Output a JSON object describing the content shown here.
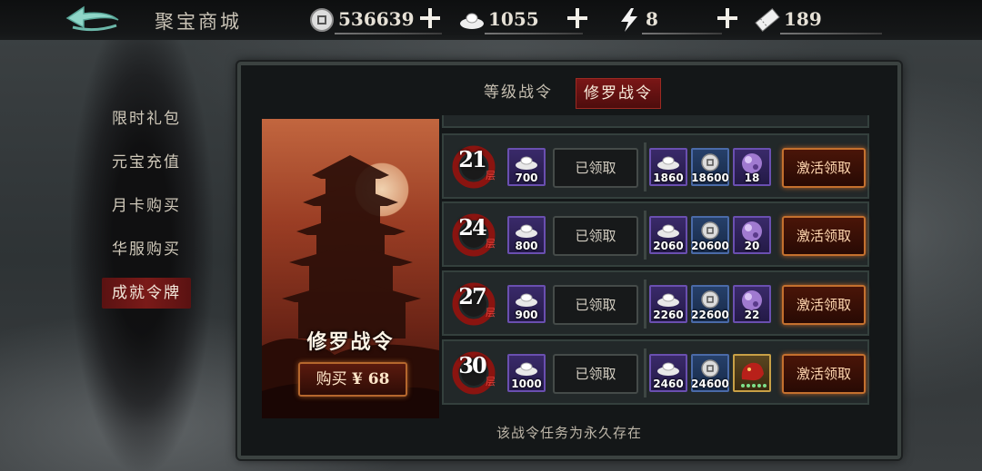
{
  "header": {
    "title": "聚宝商城",
    "resources": [
      {
        "icon": "copper-coin-icon",
        "value": "536639"
      },
      {
        "icon": "silver-ingot-icon",
        "value": "1055"
      },
      {
        "icon": "lightning-icon",
        "value": "8"
      },
      {
        "icon": "ticket-icon",
        "value": "189"
      }
    ]
  },
  "sidebar": {
    "items": [
      {
        "label": "限时礼包"
      },
      {
        "label": "元宝充值"
      },
      {
        "label": "月卡购买"
      },
      {
        "label": "华服购买"
      },
      {
        "label": "成就令牌",
        "active": true
      }
    ]
  },
  "tabs": [
    {
      "label": "等级战令"
    },
    {
      "label": "修罗战令",
      "active": true
    }
  ],
  "banner": {
    "title": "修罗战令",
    "buy_label": "购买",
    "price": "¥ 68"
  },
  "rows": [
    {
      "level": "21",
      "unit": "层",
      "free_reward": {
        "icon": "silver-ingot-icon",
        "qty": "700"
      },
      "claim_label": "已领取",
      "paid_rewards": [
        {
          "icon": "silver-ingot-icon",
          "qty": "1860"
        },
        {
          "icon": "copper-coin-icon",
          "qty": "18600"
        },
        {
          "icon": "purple-orb-icon",
          "qty": "18"
        }
      ],
      "activate_label": "激活领取"
    },
    {
      "level": "24",
      "unit": "层",
      "free_reward": {
        "icon": "silver-ingot-icon",
        "qty": "800"
      },
      "claim_label": "已领取",
      "paid_rewards": [
        {
          "icon": "silver-ingot-icon",
          "qty": "2060"
        },
        {
          "icon": "copper-coin-icon",
          "qty": "20600"
        },
        {
          "icon": "purple-orb-icon",
          "qty": "20"
        }
      ],
      "activate_label": "激活领取"
    },
    {
      "level": "27",
      "unit": "层",
      "free_reward": {
        "icon": "silver-ingot-icon",
        "qty": "900"
      },
      "claim_label": "已领取",
      "paid_rewards": [
        {
          "icon": "silver-ingot-icon",
          "qty": "2260"
        },
        {
          "icon": "copper-coin-icon",
          "qty": "22600"
        },
        {
          "icon": "purple-orb-icon",
          "qty": "22"
        }
      ],
      "activate_label": "激活领取"
    },
    {
      "level": "30",
      "unit": "层",
      "free_reward": {
        "icon": "silver-ingot-icon",
        "qty": "1000"
      },
      "claim_label": "已领取",
      "paid_rewards": [
        {
          "icon": "silver-ingot-icon",
          "qty": "2460"
        },
        {
          "icon": "copper-coin-icon",
          "qty": "24600"
        },
        {
          "icon": "red-creature-icon",
          "qty": ""
        }
      ],
      "activate_label": "激活领取"
    }
  ],
  "footer_note": "该战令任务为永久存在",
  "colors": {
    "accent_red": "#7a1616",
    "button_glow": "#c4702e",
    "panel_bg": "#141718"
  }
}
